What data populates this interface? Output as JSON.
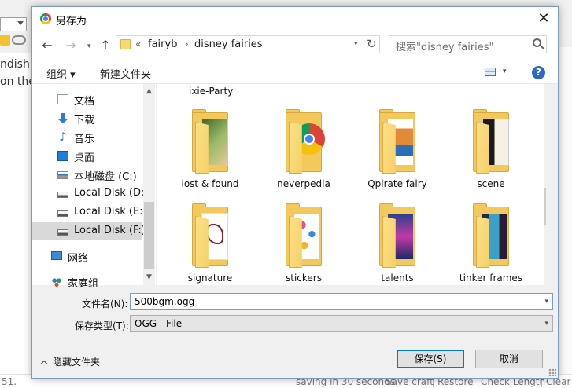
{
  "background_app": {
    "text_line1": "ndish s",
    "text_line2": "on the l",
    "status": {
      "left": "51.",
      "autosave": "saving in 30 seconds",
      "save_craft": "Save craft",
      "sep1": "|",
      "restore": "Restore",
      "check_length": "Check Length",
      "sep2": "|",
      "clear": "Clear a"
    }
  },
  "dialog": {
    "title": "另存为",
    "close_glyph": "✕",
    "nav": {
      "back": "←",
      "forward": "→",
      "recent": "▾",
      "up": "↑"
    },
    "address": {
      "overflow": "«",
      "crumbs": [
        "fairyb",
        "disney fairies"
      ],
      "separator": "›",
      "dropdown": "▾",
      "refresh": "↻"
    },
    "search": {
      "placeholder": "搜索\"disney fairies\""
    },
    "commands": {
      "organize": "组织 ▾",
      "new_folder": "新建文件夹",
      "view_drop": "▾",
      "help": "?"
    },
    "sidebar": {
      "items": [
        {
          "label": "文档",
          "icon": "documents-icon"
        },
        {
          "label": "下载",
          "icon": "downloads-icon"
        },
        {
          "label": "音乐",
          "icon": "music-icon"
        },
        {
          "label": "桌面",
          "icon": "desktop-icon"
        },
        {
          "label": "本地磁盘 (C:)",
          "icon": "drive-c-icon"
        },
        {
          "label": "Local Disk (D:)",
          "icon": "drive-icon"
        },
        {
          "label": "Local Disk (E:)",
          "icon": "drive-icon"
        },
        {
          "label": "Local Disk (F:)",
          "icon": "drive-icon",
          "selected": true
        },
        {
          "label": "网络",
          "icon": "network-icon"
        },
        {
          "label": "家庭组",
          "icon": "homegroup-icon"
        }
      ],
      "scroll_up": "▲",
      "scroll_down": "▼"
    },
    "files": {
      "partial_label": "ixie-Party",
      "items": [
        {
          "label": "lost & found",
          "icon": "folder-icon"
        },
        {
          "label": "neverpedia",
          "icon": "folder-chrome-icon"
        },
        {
          "label": "Qpirate fairy",
          "icon": "folder-icon"
        },
        {
          "label": "scene",
          "icon": "folder-icon"
        },
        {
          "label": "signature",
          "icon": "folder-icon"
        },
        {
          "label": "stickers",
          "icon": "folder-icon"
        },
        {
          "label": "talents",
          "icon": "folder-icon"
        },
        {
          "label": "tinker frames",
          "icon": "folder-icon"
        }
      ]
    },
    "filename": {
      "label": "文件名(N):",
      "value": "500bgm.ogg",
      "arrow": "▾"
    },
    "filetype": {
      "label": "保存类型(T):",
      "value": "OGG - File",
      "arrow": "▾"
    },
    "hide_folders": "隐藏文件夹",
    "save_button": "保存(S)",
    "cancel_button": "取消"
  },
  "colors": {
    "accent": "#0078d7",
    "folder": "#f3c95d",
    "selection": "#d9d9d9"
  }
}
